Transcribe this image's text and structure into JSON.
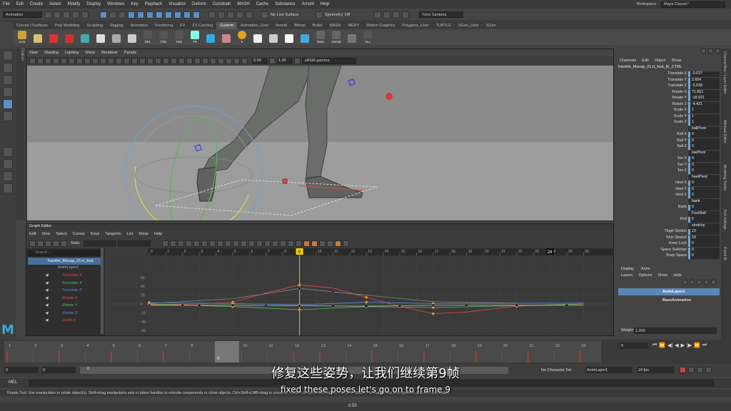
{
  "menubar": {
    "items": [
      "File",
      "Edit",
      "Create",
      "Select",
      "Modify",
      "Display",
      "Windows",
      "Key",
      "Playback",
      "Visualize",
      "Deform",
      "Constrain",
      "MASH",
      "Cache",
      "Substance",
      "Arnold",
      "Help"
    ],
    "workspace_label": "Workspace :",
    "workspace_value": "Maya Classic*"
  },
  "statusline": {
    "mode": "Animation",
    "live_surface": "No Live Surface",
    "symmetry": "Symmetry: Off",
    "user": "Yone Santana"
  },
  "shelf": {
    "tabs": [
      "Curves / Surfaces",
      "Poly Modeling",
      "Sculpting",
      "Rigging",
      "Animation",
      "Rendering",
      "FX",
      "FX Caching",
      "Custom",
      "Animation_User",
      "Arnold",
      "Bifrost",
      "Bullet",
      "MASH",
      "MERY",
      "Motion Graphics",
      "Polygons_User",
      "TURTLE",
      "XGen_User",
      "XGen"
    ],
    "active_tab": "Custom",
    "items": [
      "ALN",
      "",
      "",
      "",
      "",
      "",
      "",
      "",
      "DEL",
      "Chin",
      "Hair",
      "TR",
      "",
      "",
      "5",
      "",
      "",
      "",
      "",
      "Mute",
      "Unmut",
      "",
      "ALL"
    ]
  },
  "outliner_strip": "Outliner",
  "viewport": {
    "menu": [
      "View",
      "Shading",
      "Lighting",
      "Show",
      "Renderer",
      "Panels"
    ],
    "field1": "0.00",
    "field2": "1.00",
    "colorspace": "sRGB gamma"
  },
  "graph_editor": {
    "title": "Graph Editor",
    "menu": [
      "Edit",
      "View",
      "Select",
      "Curves",
      "Keys",
      "Tangents",
      "List",
      "Show",
      "Help"
    ],
    "stats_label": "Stats",
    "search_placeholder": "Search...",
    "object": "franklin_Mocap_01:rt_foot",
    "layer": "AnimLayer1",
    "curves": [
      {
        "name": "Translate X",
        "color": "#e04a4a"
      },
      {
        "name": "Translate Y",
        "color": "#52c152"
      },
      {
        "name": "Translate Z",
        "color": "#5a8ae0"
      },
      {
        "name": "Rotate X",
        "color": "#e04a4a"
      },
      {
        "name": "Rotate Y",
        "color": "#52c152"
      },
      {
        "name": "Rotate Z",
        "color": "#5a8ae0"
      },
      {
        "name": "Scale X",
        "color": "#e04a4a"
      }
    ],
    "ruler_ticks": [
      "0",
      "1",
      "2",
      "3",
      "4",
      "5",
      "6",
      "7",
      "8",
      "9",
      "10",
      "11",
      "12",
      "13",
      "14",
      "15",
      "16",
      "17",
      "18",
      "19",
      "20",
      "21",
      "22",
      "23",
      "24",
      "25",
      "26"
    ],
    "current_frame": "9",
    "end_frame": "24",
    "y_ticks": [
      "60",
      "40",
      "20",
      "0",
      "-20",
      "-40",
      "-60"
    ]
  },
  "channel_box": {
    "menu": [
      "Channels",
      "Edit",
      "Object",
      "Show"
    ],
    "object": "franklin_Mocap_01:rt_foot_IK_CTRL",
    "rows": [
      {
        "label": "Translate X",
        "value": "-0.027"
      },
      {
        "label": "Translate Y",
        "value": "2.604"
      },
      {
        "label": "Translate Z",
        "value": "-5.638"
      },
      {
        "label": "Rotate X",
        "value": "71.651"
      },
      {
        "label": "Rotate Y",
        "value": "-18.921"
      },
      {
        "label": "Rotate Z",
        "value": "-4.421"
      },
      {
        "label": "Scale X",
        "value": "1"
      },
      {
        "label": "Scale Y",
        "value": "1"
      },
      {
        "label": "Scale Z",
        "value": "1"
      },
      {
        "label": "",
        "value": "ballPivot"
      },
      {
        "label": "Ball X",
        "value": "0"
      },
      {
        "label": "Ball Y",
        "value": "0"
      },
      {
        "label": "Ball Z",
        "value": "0"
      },
      {
        "label": "",
        "value": "toePivot"
      },
      {
        "label": "Toe X",
        "value": "0"
      },
      {
        "label": "Toe Y",
        "value": "0"
      },
      {
        "label": "Toe Z",
        "value": "0"
      },
      {
        "label": "",
        "value": "heelPivot"
      },
      {
        "label": "Heel X",
        "value": "0"
      },
      {
        "label": "Heel Y",
        "value": "0"
      },
      {
        "label": "Heel Z",
        "value": "0"
      },
      {
        "label": "",
        "value": "bank"
      },
      {
        "label": "Bank",
        "value": "0"
      },
      {
        "label": "",
        "value": "FootRoll"
      },
      {
        "label": "Roll",
        "value": "0"
      },
      {
        "label": "",
        "value": "stretchy"
      },
      {
        "label": "Thigh Stretch",
        "value": "10"
      },
      {
        "label": "Shin Stretch",
        "value": "10"
      },
      {
        "label": "Knee Lock",
        "value": "0"
      },
      {
        "label": "Space Switcher",
        "value": "0"
      },
      {
        "label": "Body Space",
        "value": "0"
      }
    ]
  },
  "side_tabs": [
    "Channel Box / Layer Editor",
    "Attribute Editor",
    "Modeling Toolkit",
    "Tool Settings",
    "Rurkit IK"
  ],
  "layers": {
    "tabs": [
      "Display",
      "Anim"
    ],
    "menu": [
      "Layers",
      "Options",
      "Show",
      "Help"
    ],
    "items": [
      "AnimLayer1",
      "BaseAnimation"
    ],
    "weight_label": "Weight",
    "weight_value": "1.000"
  },
  "timeslider": {
    "ticks": [
      "1",
      "2",
      "3",
      "4",
      "5",
      "6",
      "7",
      "8",
      "9",
      "10",
      "11",
      "12",
      "13",
      "14",
      "15",
      "16",
      "17",
      "18",
      "19",
      "20",
      "21",
      "22",
      "23",
      "24"
    ],
    "current": "9",
    "field": "9"
  },
  "range": {
    "start": "0",
    "start2": "0",
    "inner_start": "0",
    "character_set": "No Character Set",
    "anim_layer": "AnimLayer1",
    "fps": "24 fps"
  },
  "mel": {
    "label": "MEL"
  },
  "help_line": "Rotate Tool: Use manipulator to rotate object(s). Shift+drag manipulator axis or plane handles to extrude components or clone objects. Ctrl+Shift+LMB+drag to constrain rotation to connected edges. Use D or INSERT to change the pivot position and axis orientation.",
  "bottombar": {
    "value": "0.50"
  },
  "subtitle": {
    "chinese": "修复这些姿势，让我们继续第9帧",
    "english": "fixed these poses let's go on to frame 9"
  },
  "logo": "M"
}
